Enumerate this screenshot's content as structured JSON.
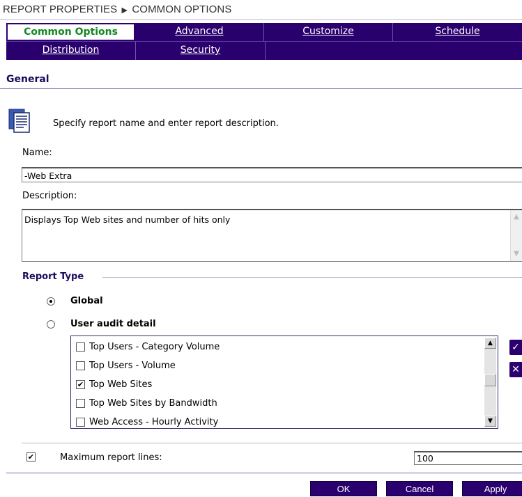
{
  "breadcrumb": {
    "part1": "REPORT PROPERTIES",
    "separator": "▶",
    "part2": "COMMON OPTIONS"
  },
  "tabs": {
    "row1": [
      "Common Options",
      "Advanced",
      "Customize",
      "Schedule"
    ],
    "row2": [
      "Distribution",
      "Security"
    ],
    "active": "Common Options"
  },
  "general": {
    "title": "General",
    "intro": "Specify report name and enter report description.",
    "name_label": "Name:",
    "name_value": "-Web Extra",
    "description_label": "Description:",
    "description_value": "Displays Top Web sites and number of hits only"
  },
  "report_type": {
    "title": "Report Type",
    "options": [
      {
        "label": "Global",
        "selected": true
      },
      {
        "label": "User audit detail",
        "selected": false
      }
    ],
    "list_items": [
      {
        "label": "Top Users - Category Volume",
        "checked": false
      },
      {
        "label": "Top Users - Volume",
        "checked": false
      },
      {
        "label": "Top Web Sites",
        "checked": true
      },
      {
        "label": "Top Web Sites by Bandwidth",
        "checked": false
      },
      {
        "label": "Web Access - Hourly Activity",
        "checked": false
      }
    ]
  },
  "max_lines": {
    "checked": true,
    "label": "Maximum report lines:",
    "value": "100"
  },
  "buttons": {
    "ok": "OK",
    "cancel": "Cancel",
    "apply": "Apply"
  },
  "colors": {
    "accent": "#2a006e",
    "active_tab_text": "#118a1f",
    "heading": "#1c0a5c"
  }
}
